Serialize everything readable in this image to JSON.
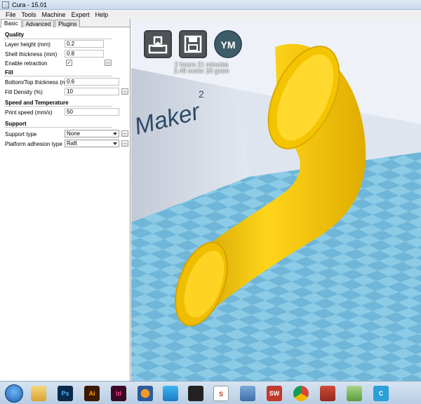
{
  "window": {
    "title": "Cura - 15.01"
  },
  "menubar": {
    "items": [
      "File",
      "Tools",
      "Machine",
      "Expert",
      "Help"
    ]
  },
  "tabs": [
    "Basic",
    "Advanced",
    "Plugins"
  ],
  "sections": {
    "quality": {
      "title": "Quality",
      "layer_height_label": "Layer height (mm)",
      "layer_height_value": "0.2",
      "shell_thickness_label": "Shell thickness (mm)",
      "shell_thickness_value": "0.8",
      "enable_retraction_label": "Enable retraction",
      "enable_retraction_checked": "✓",
      "dots": "..."
    },
    "fill": {
      "title": "Fill",
      "bottom_top_label": "Bottom/Top thickness (mm)",
      "bottom_top_value": "0.6",
      "fill_density_label": "Fill Density (%)",
      "fill_density_value": "10",
      "dots": "..."
    },
    "speed": {
      "title": "Speed and Temperature",
      "print_speed_label": "Print speed (mm/s)",
      "print_speed_value": "50"
    },
    "support": {
      "title": "Support",
      "support_type_label": "Support type",
      "support_type_value": "None",
      "adhesion_label": "Platform adhesion type",
      "adhesion_value": "Raft",
      "dots": "..."
    }
  },
  "viewport": {
    "toolbar": {
      "load_icon": "load-model-icon",
      "save_icon": "save-toolpath-icon",
      "ym_label": "YM"
    },
    "print_info": {
      "time": "2 hours 21 minutes",
      "material": "2.49 meter 20 gram"
    },
    "machine_logo_text": "Maker",
    "machine_logo_sup": "2",
    "colors": {
      "model": "#f2c200",
      "bed_light": "#8ccbe6",
      "bed_dark": "#6fb6d8"
    }
  },
  "taskbar": {
    "icons": [
      "start-orb",
      "explorer-icon",
      "photoshop-icon",
      "illustrator-icon",
      "indesign-icon",
      "blender-icon",
      "arrow-app-icon",
      "inkscape-icon",
      "sketchup-icon",
      "virtualbox-icon",
      "solidworks-icon",
      "chrome-icon",
      "settings-app-icon",
      "notepad-icon",
      "cura-icon"
    ],
    "labels": {
      "ps": "Ps",
      "ai": "Ai",
      "id": "Id",
      "s": "S",
      "sw": "SW",
      "c": "C"
    }
  }
}
